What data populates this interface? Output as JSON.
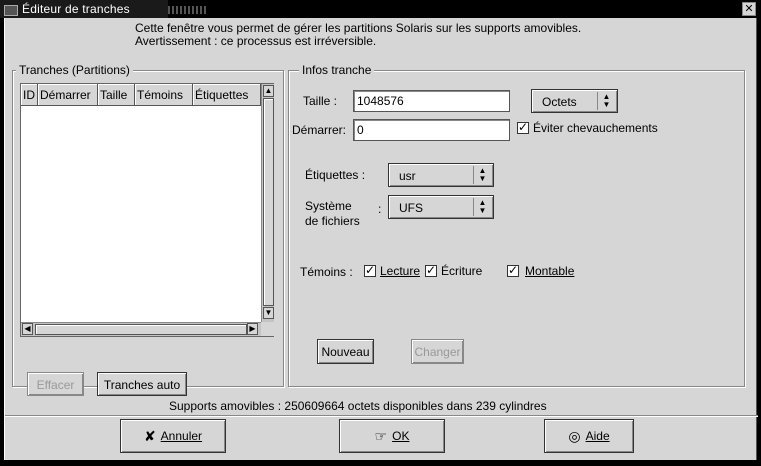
{
  "window": {
    "title": "Éditeur de tranches",
    "close_label": "✕"
  },
  "info": {
    "line1": "Cette fenêtre vous permet de gérer les partitions Solaris sur les supports amovibles.",
    "line2": "Avertissement : ce processus est irréversible."
  },
  "slices": {
    "title": "Tranches (Partitions)",
    "columns": [
      "ID",
      "Démarrer",
      "Taille",
      "Témoins",
      "Étiquettes"
    ],
    "rows": [],
    "delete_button": "Effacer",
    "auto_button": "Tranches auto"
  },
  "slice_info": {
    "title": "Infos tranche",
    "size_label": "Taille :",
    "size_value": "1048576",
    "unit_value": "Octets",
    "start_label": "Démarrer:",
    "start_value": "0",
    "avoid_overlap_label": "Éviter chevauchements",
    "avoid_overlap_checked": true,
    "tags_label": "Étiquettes :",
    "tags_value": "usr",
    "fs_label_line1": "Système",
    "fs_label_line2": "de fichiers",
    "fs_colon": ":",
    "fs_value": "UFS",
    "flags_label": "Témoins :",
    "flag_read": "Lecture",
    "flag_write": "Écriture",
    "flag_mount": "Montable",
    "new_button": "Nouveau",
    "change_button": "Changer"
  },
  "status": {
    "label": "Supports amovibles :",
    "text": "250609664 octets disponibles dans 239 cylindres"
  },
  "footer": {
    "cancel_label": "Annuler",
    "ok_label": "OK",
    "help_label": "Aide"
  }
}
